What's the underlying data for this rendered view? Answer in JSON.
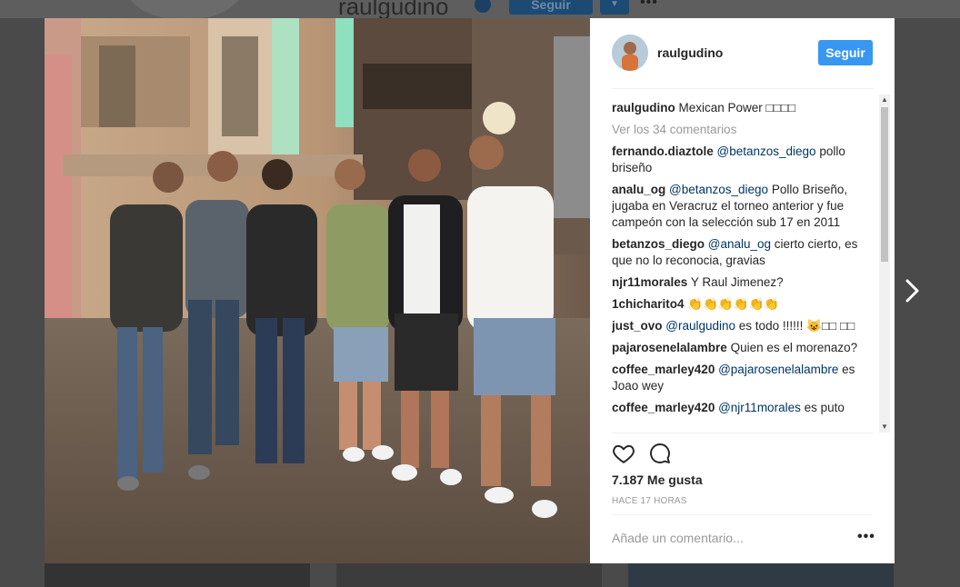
{
  "background_profile": {
    "username": "raulgudino",
    "follow_label": "Seguir",
    "more_label": "•••"
  },
  "post": {
    "header": {
      "username": "raulgudino",
      "follow_label": "Seguir"
    },
    "caption": {
      "username": "raulgudino",
      "text": "Mexican Power □□□□"
    },
    "view_all_comments": "Ver los 34 comentarios",
    "comments": [
      {
        "user": "fernando.diaztole",
        "mention": "@betanzos_diego",
        "text": " pollo briseño"
      },
      {
        "user": "analu_og",
        "mention": "@betanzos_diego",
        "text": " Pollo Briseño, jugaba en Veracruz el torneo anterior y fue campeón con la selección sub 17 en 2011"
      },
      {
        "user": "betanzos_diego",
        "mention": "@analu_og",
        "text": " cierto cierto, es que no lo reconocia, gravias"
      },
      {
        "user": "njr11morales",
        "mention": "",
        "text": "Y Raul Jimenez?"
      },
      {
        "user": "1chicharito4",
        "mention": "",
        "text": "👏👏👏👏👏👏"
      },
      {
        "user": "just_ovo",
        "mention": "@raulgudino",
        "text": " es todo !!!!!! 😺□□ □□"
      },
      {
        "user": "pajarosenelalambre",
        "mention": "",
        "text": "Quien es el morenazo?"
      },
      {
        "user": "coffee_marley420",
        "mention": "@pajarosenelalambre",
        "text": " es Joao wey"
      },
      {
        "user": "coffee_marley420",
        "mention": "@njr11morales",
        "text": " es puto"
      }
    ],
    "likes_label": "7.187 Me gusta",
    "timestamp": "HACE 17 HORAS",
    "comment_placeholder": "Añade un comentario...",
    "more_options": "•••"
  },
  "icons": [
    "heart-icon",
    "comment-icon",
    "chevron-right-icon",
    "scroll-up-icon",
    "scroll-down-icon"
  ],
  "colors": {
    "accent": "#3897f0",
    "mention": "#003569",
    "muted": "#999999",
    "text": "#262626"
  }
}
